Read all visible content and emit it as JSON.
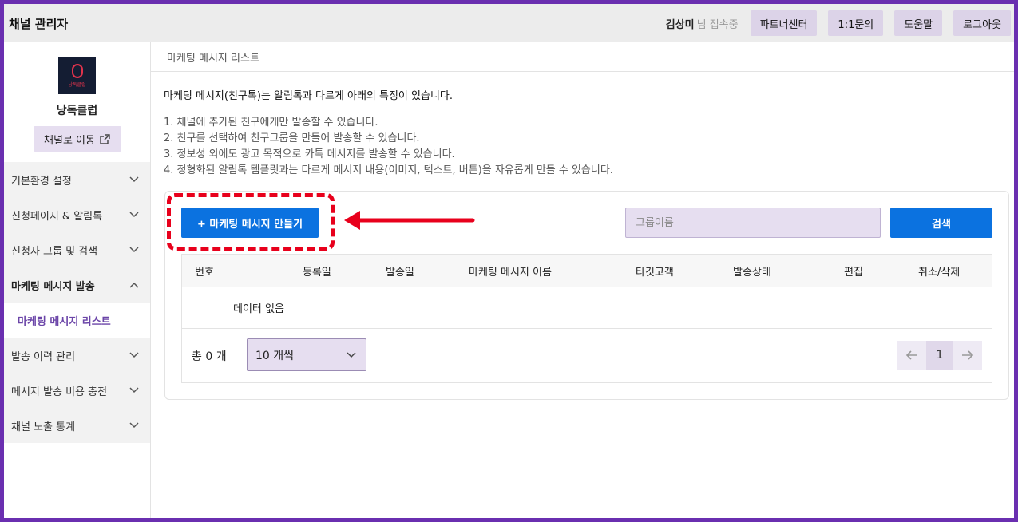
{
  "header": {
    "app_title": "채널 관리자",
    "user_name": "김상미",
    "user_status": "님 접속중",
    "buttons": [
      "파트너센터",
      "1:1문의",
      "도움말",
      "로그아웃"
    ]
  },
  "sidebar": {
    "logo_text": "낭독클럽",
    "channel_name": "낭독클럽",
    "goto_channel_label": "채널로 이동",
    "items": [
      {
        "label": "기본환경 설정",
        "expanded": false
      },
      {
        "label": "신청페이지 & 알림톡",
        "expanded": false
      },
      {
        "label": "신청자 그룹 및 검색",
        "expanded": false
      },
      {
        "label": "마케팅 메시지 발송",
        "expanded": true
      },
      {
        "label": "발송 이력 관리",
        "expanded": false
      },
      {
        "label": "메시지 발송 비용 충전",
        "expanded": false
      },
      {
        "label": "채널 노출 통계",
        "expanded": false
      }
    ],
    "active_sub_item": "마케팅 메시지 리스트"
  },
  "main": {
    "breadcrumb": "마케팅 메시지 리스트",
    "intro": "마케팅 메시지(친구톡)는 알림톡과 다르게 아래의 특징이 있습니다.",
    "features": [
      "1. 채널에 추가된 친구에게만 발송할 수 있습니다.",
      "2. 친구를 선택하여 친구그룹을 만들어 발송할 수 있습니다.",
      "3. 정보성 외에도 광고 목적으로 카톡 메시지를 발송할 수 있습니다.",
      "4. 정형화된 알림톡 템플릿과는 다르게 메시지 내용(이미지, 텍스트, 버튼)을 자유롭게 만들 수 있습니다."
    ],
    "create_button": "+ 마케팅 메시지 만들기",
    "group_placeholder": "그룹이름",
    "search_button": "검색",
    "table": {
      "columns": [
        "번호",
        "등록일",
        "발송일",
        "마케팅 메시지 이름",
        "타깃고객",
        "발송상태",
        "편집",
        "취소/삭제"
      ],
      "empty_text": "데이터 없음"
    },
    "total_label": "총 0 개",
    "page_size": "10 개씩",
    "current_page": "1"
  },
  "colors": {
    "primary": "#0b72e0",
    "accent_light": "#e6def0",
    "highlight_red": "#e8001c",
    "border_purple": "#6a2fb0"
  }
}
